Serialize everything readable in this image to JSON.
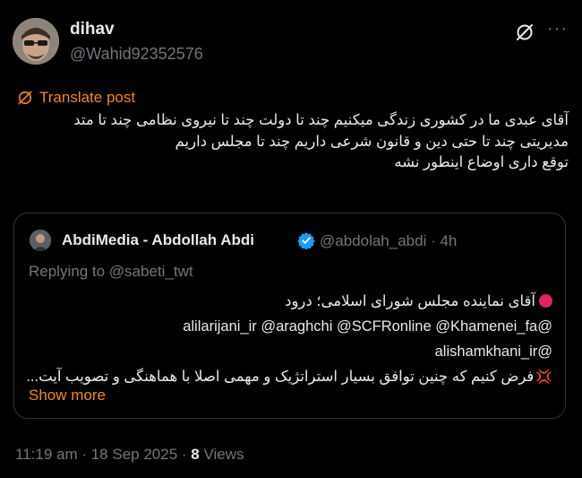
{
  "author": {
    "name": "dihav",
    "handle": "@Wahid92352576"
  },
  "translate_label": "Translate post",
  "post_lines": [
    "آقای عبدی ما در کشوری زندگی میکنیم چند تا دولت چند تا نیروی نظامی چند تا متد",
    "مدیریتی چند تا حتی دین و قانون شرعی داریم چند تا مجلس داریم",
    "توقع داری اوضاع اینطور نشه"
  ],
  "quote": {
    "name": "AbdiMedia - Abdollah Abdi",
    "handle_time": "@abdolah_abdi · 4h",
    "replying_to": "Replying to @sabeti_twt",
    "lines": [
      "آقای نماینده مجلس شورای اسلامی؛ درود",
      "@alilarijani_ir @araghchi @SCFRonline @Khamenei_fa",
      "@alishamkhani_ir",
      "فرض کنیم که چنین توافق بسیار استراتژیک و مهمی اصلا با هماهنگی و تصویب آیت..."
    ],
    "show_more": "Show more"
  },
  "meta": {
    "timestamp": "11:19 am · 18 Sep 2025 · ",
    "views_count": "8",
    "views_label": " Views"
  },
  "colors": {
    "background": "#000000",
    "accent": "#f4891a",
    "muted": "#71767b",
    "verified": "#1d9bf0"
  }
}
